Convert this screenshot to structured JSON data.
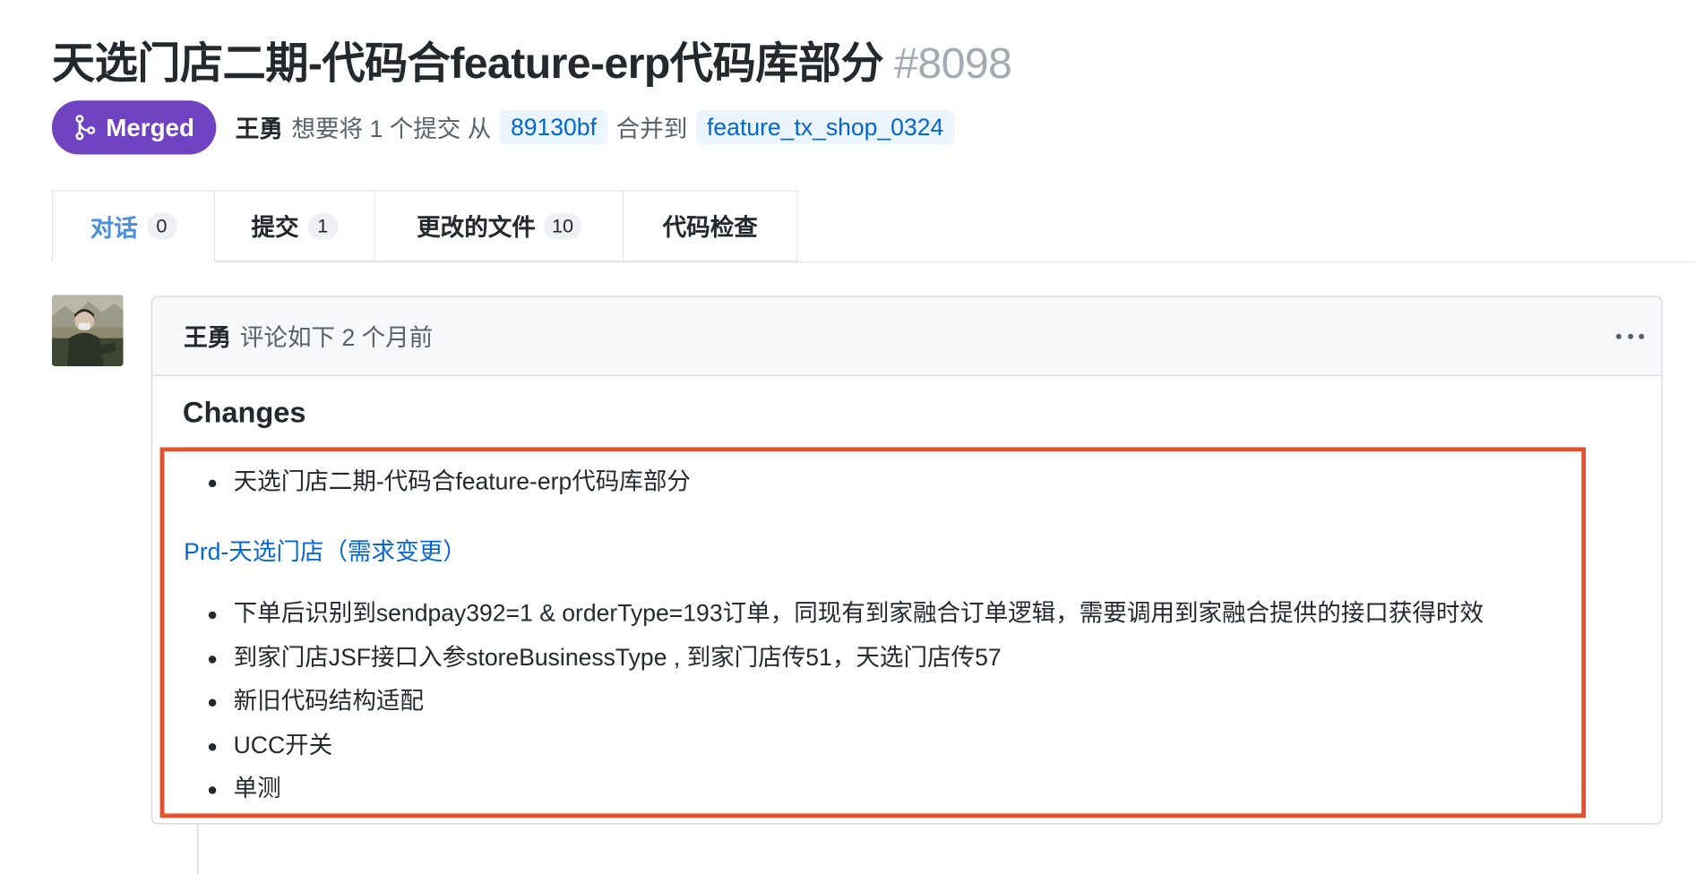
{
  "pr": {
    "title": "天选门店二期-代码合feature-erp代码库部分",
    "number": "#8098",
    "status": "Merged",
    "author": "王勇",
    "text_want": "想要将 1 个提交 从",
    "source_branch": "89130bf",
    "text_merge_into": "合并到",
    "target_branch": "feature_tx_shop_0324"
  },
  "tabs": [
    {
      "label": "对话",
      "count": "0"
    },
    {
      "label": "提交",
      "count": "1"
    },
    {
      "label": "更改的文件",
      "count": "10"
    },
    {
      "label": "代码检查",
      "count": ""
    }
  ],
  "comment": {
    "author": "王勇",
    "meta": "评论如下 2 个月前",
    "heading": "Changes",
    "list1": [
      "天选门店二期-代码合feature-erp代码库部分"
    ],
    "link": "Prd-天选门店（需求变更）",
    "list2": [
      "下单后识别到sendpay392=1 & orderType=193订单，同现有到家融合订单逻辑，需要调用到家融合提供的接口获得时效",
      "到家门店JSF接口入参storeBusinessType , 到家门店传51，天选门店传57",
      "新旧代码结构适配",
      "UCC开关",
      "单测"
    ]
  },
  "colors": {
    "merged": "#6f42c1",
    "link": "#0366d6",
    "highlight": "#e5502a",
    "tab_selected": "#4a90d9"
  },
  "icons": {
    "merge": "git-merge-icon",
    "more": "kebab-horizontal-icon",
    "avatar": "user-avatar"
  }
}
